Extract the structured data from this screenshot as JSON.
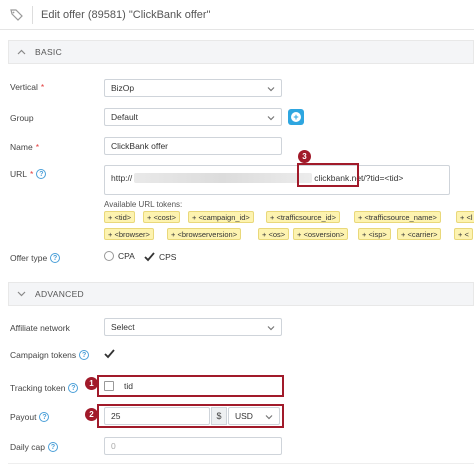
{
  "header": {
    "title": "Edit offer (89581) \"ClickBank offer\"",
    "icon": "tags-icon"
  },
  "sections": {
    "basic": "BASIC",
    "advanced": "ADVANCED"
  },
  "fields": {
    "vertical": {
      "label": "Vertical",
      "required": "*",
      "value": "BizOp"
    },
    "group": {
      "label": "Group",
      "value": "Default"
    },
    "name": {
      "label": "Name",
      "required": "*",
      "value": "ClickBank offer"
    },
    "url": {
      "label": "URL",
      "required": "*",
      "prefix": "http://",
      "suffix": "clickbank.net/?tid=<tid>"
    },
    "offer_type": {
      "label": "Offer type",
      "options": [
        "CPA",
        "CPS"
      ],
      "selected": "CPS"
    },
    "affiliate_network": {
      "label": "Affiliate network",
      "value": "Select"
    },
    "campaign_tokens": {
      "label": "Campaign tokens",
      "checked": true
    },
    "tracking_token": {
      "label": "Tracking token",
      "value": "tid",
      "checked": false
    },
    "payout": {
      "label": "Payout",
      "value": "25",
      "currency_sign": "$",
      "currency": "USD"
    },
    "daily_cap": {
      "label": "Daily cap",
      "placeholder": "0"
    }
  },
  "tokens": {
    "label": "Available URL tokens:",
    "row1": [
      "+ <tid>",
      "+ <cost>",
      "+ <campaign_id>",
      "+ <trafficsource_id>",
      "+ <trafficsource_name>",
      "+ <l"
    ],
    "row2": [
      "+ <browser>",
      "+ <browserversion>",
      "+ <os>",
      "+ <osversion>",
      "+ <isp>",
      "+ <carrier>",
      "+ <"
    ]
  },
  "annotations": [
    "1",
    "2",
    "3"
  ],
  "colors": {
    "accent": "#2ea6e0",
    "annotation": "#a11a2a",
    "token_bg": "#fdf3b0",
    "required": "#e23d3d"
  }
}
